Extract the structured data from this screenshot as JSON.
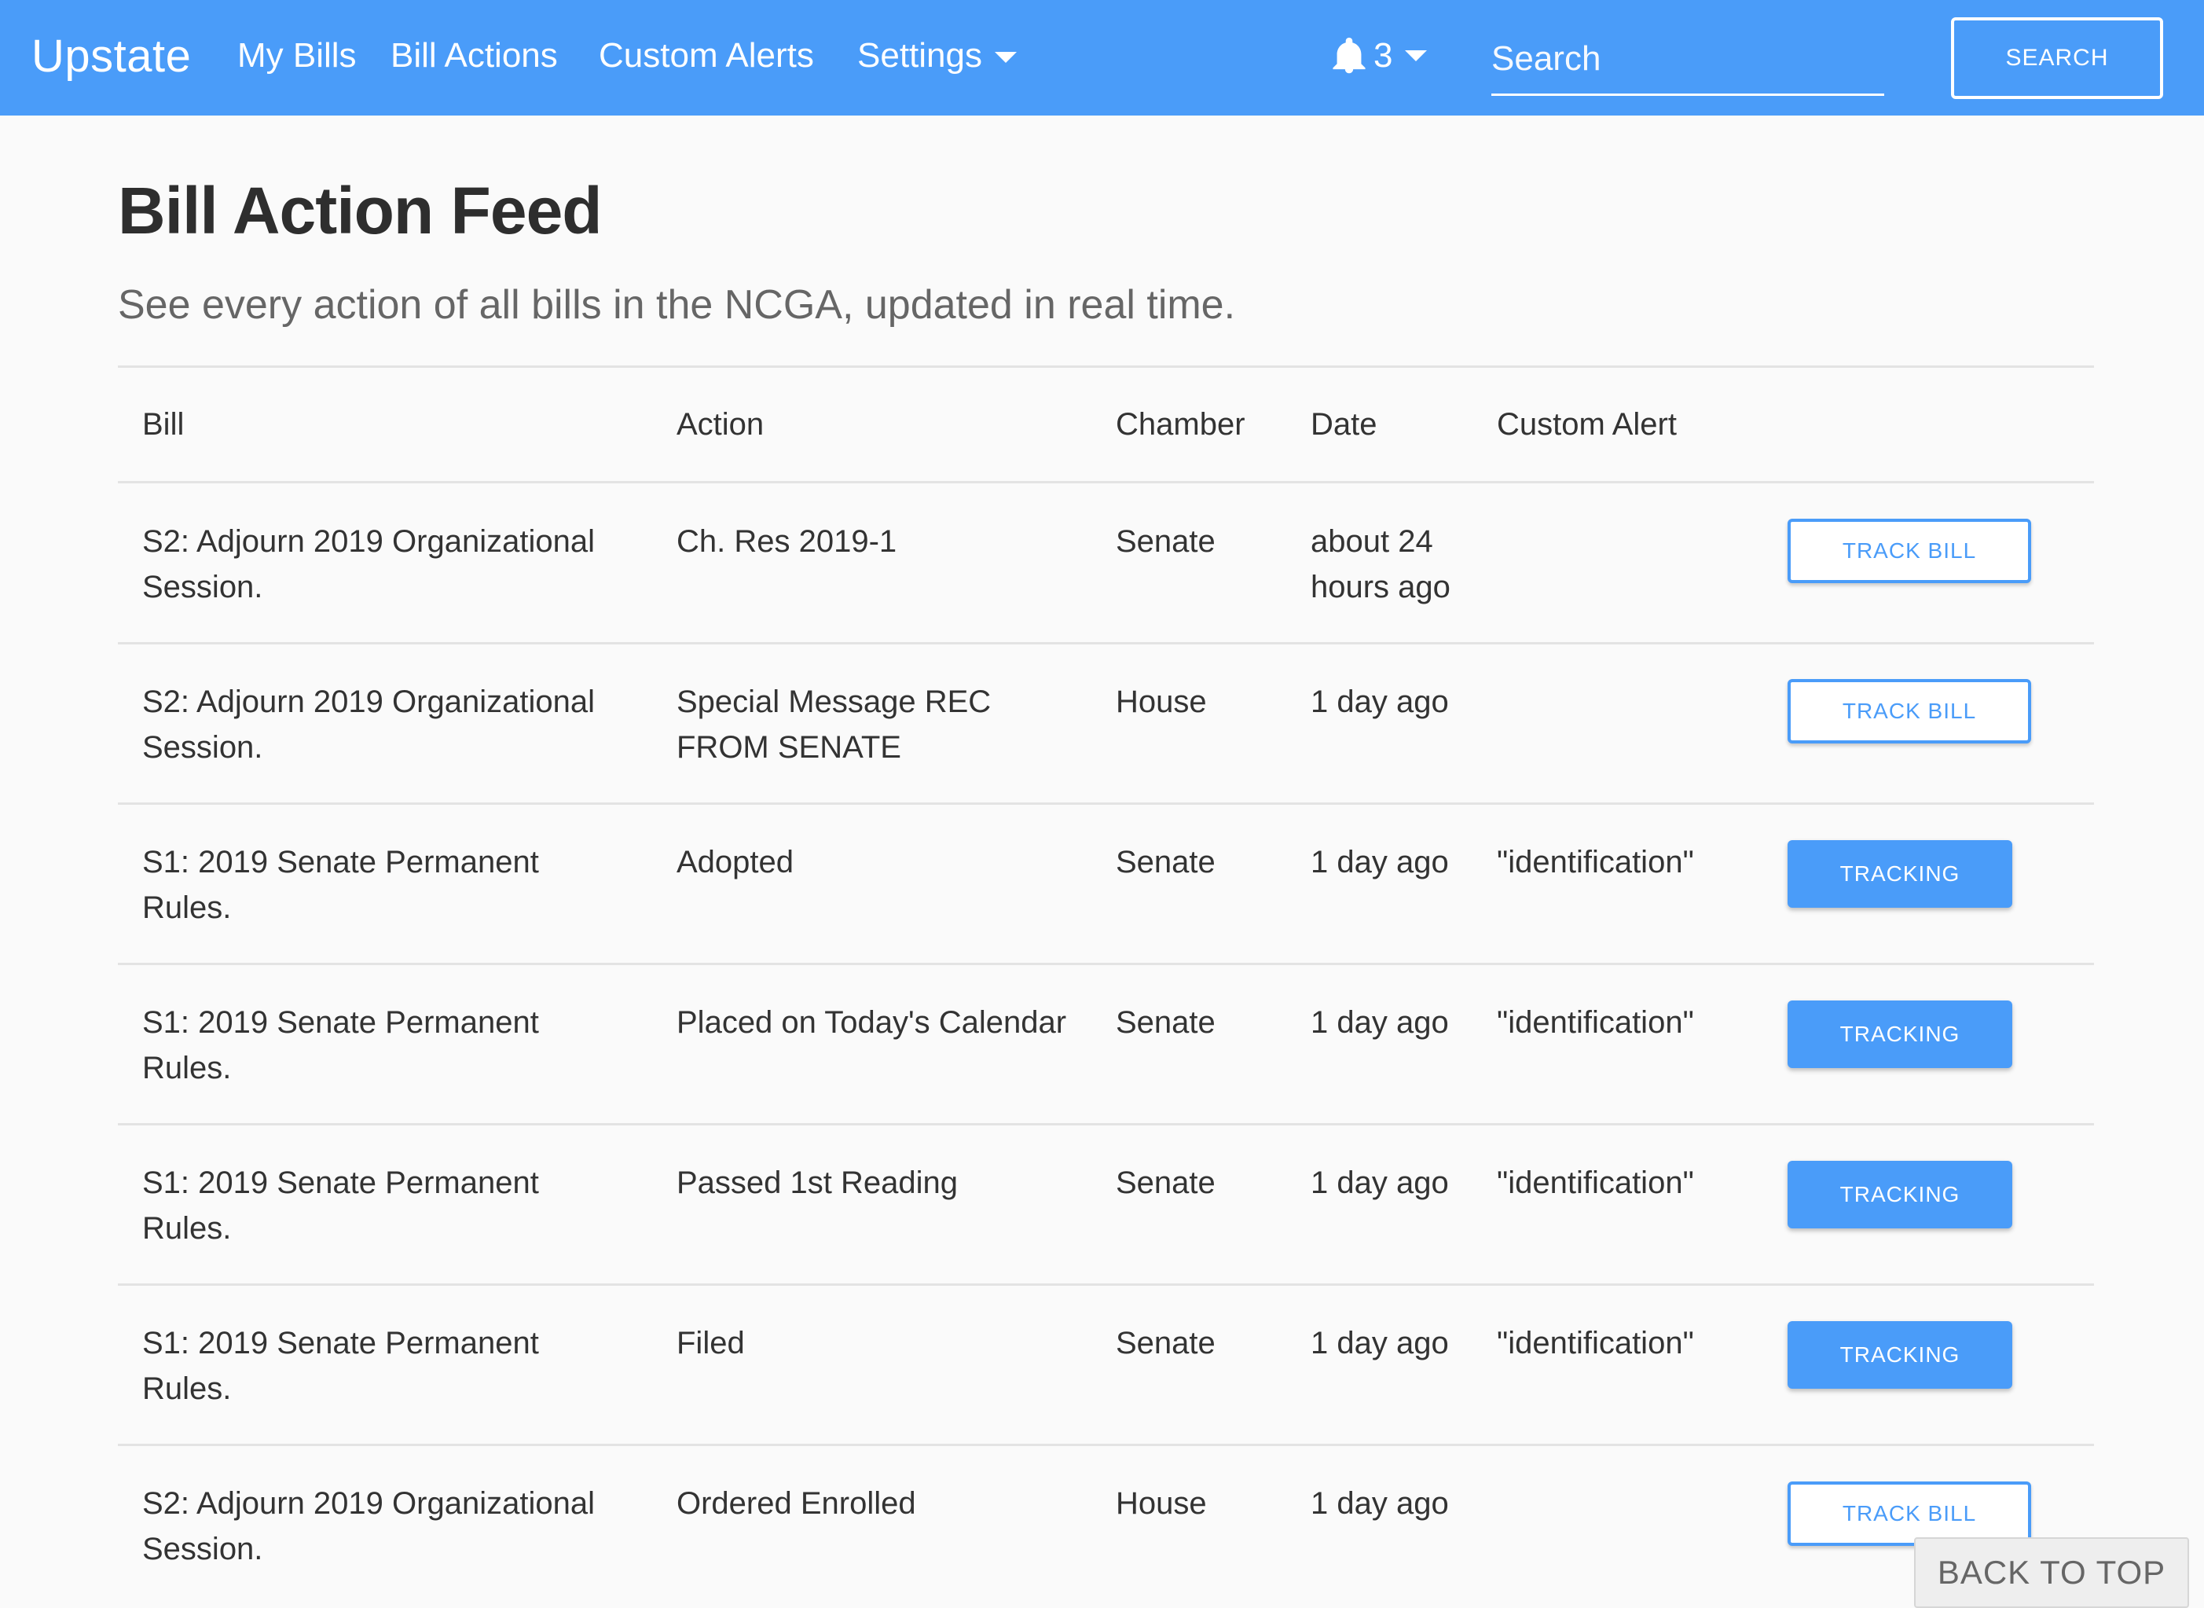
{
  "nav": {
    "brand": "Upstate",
    "my_bills": "My Bills",
    "bill_actions": "Bill Actions",
    "custom_alerts": "Custom Alerts",
    "settings": "Settings",
    "notification_count": "3",
    "search_placeholder": "Search",
    "search_button": "SEARCH"
  },
  "page": {
    "title": "Bill Action Feed",
    "subtitle": "See every action of all bills in the NCGA, updated in real time."
  },
  "table": {
    "headers": [
      "Bill",
      "Action",
      "Chamber",
      "Date",
      "Custom Alert"
    ],
    "rows": [
      {
        "bill_line1": "S2: Adjourn 2019 Organizational",
        "bill_line2": "Session.",
        "action_line1": "Ch. Res 2019-1",
        "action_line2": "",
        "chamber": "Senate",
        "date_line1": "about 24",
        "date_line2": "hours ago",
        "alert": "",
        "button": "TRACK BILL"
      },
      {
        "bill_line1": "S2: Adjourn 2019 Organizational",
        "bill_line2": "Session.",
        "action_line1": "Special Message REC",
        "action_line2": "FROM SENATE",
        "chamber": "House",
        "date_line1": "1 day ago",
        "date_line2": "",
        "alert": "",
        "button": "TRACK BILL"
      },
      {
        "bill_line1": "S1: 2019 Senate Permanent",
        "bill_line2": "Rules.",
        "action_line1": "Adopted",
        "action_line2": "",
        "chamber": "Senate",
        "date_line1": "1 day ago",
        "date_line2": "",
        "alert": "\"identification\"",
        "button": "TRACKING"
      },
      {
        "bill_line1": "S1: 2019 Senate Permanent",
        "bill_line2": "Rules.",
        "action_line1": "Placed on Today's Calendar",
        "action_line2": "",
        "chamber": "Senate",
        "date_line1": "1 day ago",
        "date_line2": "",
        "alert": "\"identification\"",
        "button": "TRACKING"
      },
      {
        "bill_line1": "S1: 2019 Senate Permanent",
        "bill_line2": "Rules.",
        "action_line1": "Passed 1st Reading",
        "action_line2": "",
        "chamber": "Senate",
        "date_line1": "1 day ago",
        "date_line2": "",
        "alert": "\"identification\"",
        "button": "TRACKING"
      },
      {
        "bill_line1": "S1: 2019 Senate Permanent",
        "bill_line2": "Rules.",
        "action_line1": "Filed",
        "action_line2": "",
        "chamber": "Senate",
        "date_line1": "1 day ago",
        "date_line2": "",
        "alert": "\"identification\"",
        "button": "TRACKING"
      },
      {
        "bill_line1": "S2: Adjourn 2019 Organizational",
        "bill_line2": "Session.",
        "action_line1": "Ordered Enrolled",
        "action_line2": "",
        "chamber": "House",
        "date_line1": "1 day ago",
        "date_line2": "",
        "alert": "",
        "button": "TRACK BILL"
      }
    ]
  },
  "back_to_top": "BACK TO TOP",
  "colors": {
    "brand_blue": "#4a9cf9",
    "background": "#fafafa"
  },
  "icons": {
    "notifications": "bell-icon",
    "dropdown": "caret-down-icon"
  }
}
